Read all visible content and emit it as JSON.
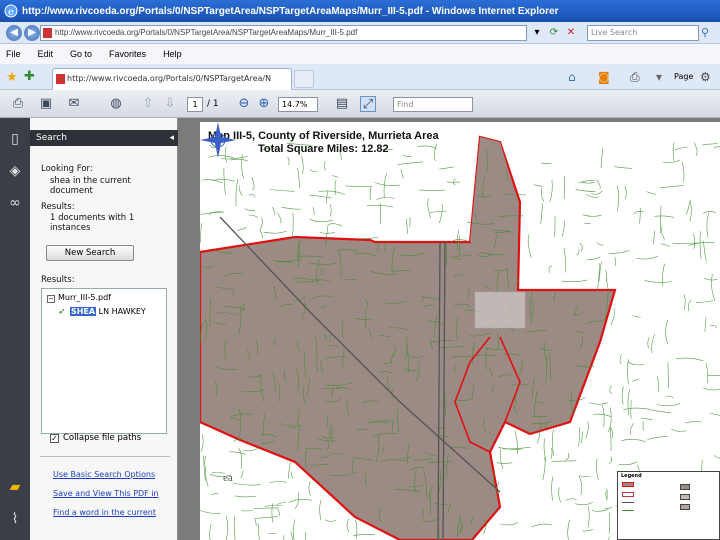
{
  "window": {
    "title": "http://www.rivcoeda.org/Portals/0/NSPTargetArea/NSPTargetAreaMaps/Murr_III-5.pdf - Windows Internet Explorer"
  },
  "address_bar": {
    "url": "http://www.rivcoeda.org/Portals/0/NSPTargetArea/NSPTargetAreaMaps/Murr_III-5.pdf",
    "search_placeholder": "Live Search"
  },
  "menu": [
    "File",
    "Edit",
    "Go to",
    "Favorites",
    "Help"
  ],
  "tab": {
    "label": "http://www.rivcoeda.org/Portals/0/NSPTargetArea/N"
  },
  "command_bar": {
    "page_label": "Page"
  },
  "reader_toolbar": {
    "page_number": "1",
    "page_count": "/ 1",
    "zoom": "14.7%",
    "find_placeholder": "Find"
  },
  "search_panel": {
    "header": "Search",
    "looking_for_label": "Looking For:",
    "query_text": "shea in the current document",
    "results_label": "Results:",
    "results_summary": "1 documents with 1 instances",
    "new_search_button": "New Search",
    "results_list_label": "Results:",
    "result_file": "Murr_III-5.pdf",
    "result_hit_highlight": "SHEA",
    "result_hit_rest": "LN HAWKEY",
    "collapse_label": "Collapse file paths",
    "links": [
      "Use Basic Search Options",
      "Save and View This PDF in",
      "Find a word in the current"
    ]
  },
  "map": {
    "title_line1": "Map III-5, County of Riverside, Murrieta Area",
    "title_line2": "Total Square Miles: 12.82",
    "legend_title": "Legend",
    "logo_text": "ea",
    "colors": {
      "target_area_fill": "#9c8a84",
      "target_border": "#e01010",
      "streets": "#3f8f2f",
      "highway": "#555555"
    }
  }
}
